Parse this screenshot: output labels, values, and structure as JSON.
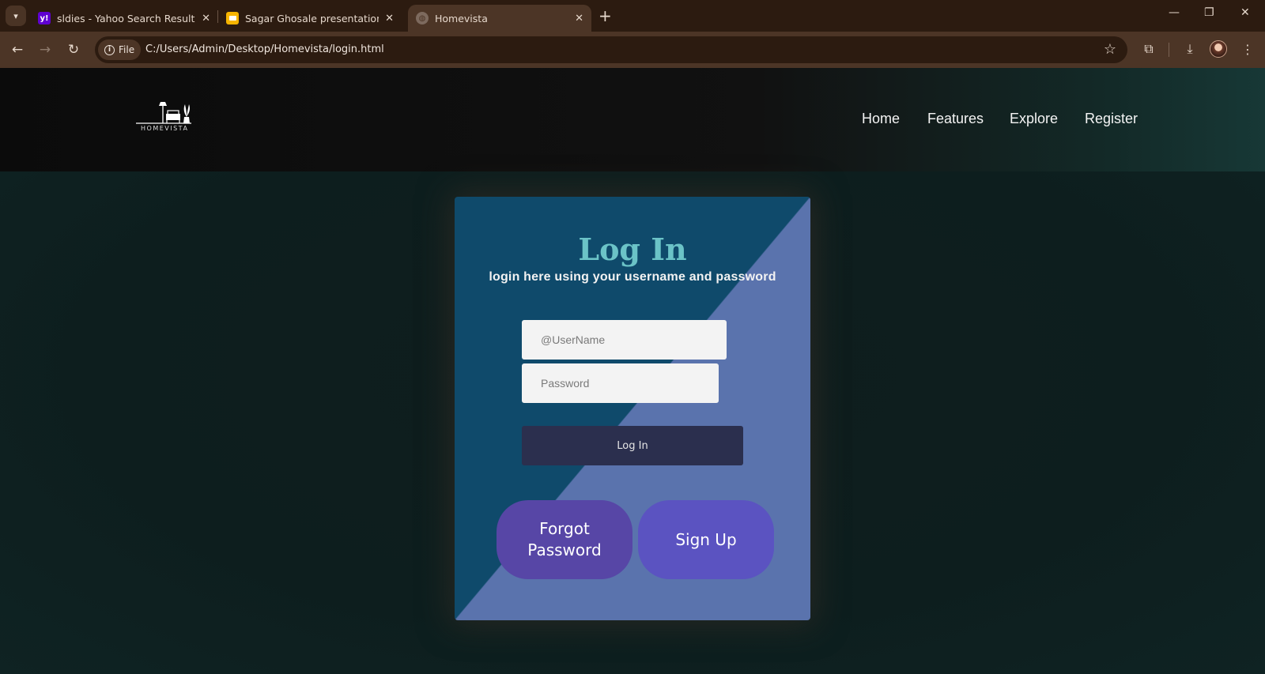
{
  "browser": {
    "tabs": [
      {
        "title": "sldies - Yahoo Search Results",
        "favicon": "yahoo-icon",
        "favicon_color": "#5f01d1"
      },
      {
        "title": "Sagar Ghosale presentation - G",
        "favicon": "slides-icon",
        "favicon_color": "#f6b400"
      },
      {
        "title": "Homevista",
        "favicon": "globe-icon",
        "active": true
      }
    ],
    "new_tab": "+",
    "address": {
      "chip_label": "File",
      "url": "C:/Users/Admin/Desktop/Homevista/login.html"
    }
  },
  "site": {
    "logo_text": "HOMEVISTA",
    "nav": [
      "Home",
      "Features",
      "Explore",
      "Register"
    ]
  },
  "login": {
    "title": "Log In",
    "subtitle": "login here using your username and password",
    "username_placeholder": "@UserName",
    "password_placeholder": "Password",
    "login_button": "Log In",
    "forgot_line1": "Forgot",
    "forgot_line2": "Password",
    "signup": "Sign Up"
  },
  "colors": {
    "card_dark": "#0f4a6b",
    "card_light": "#5a73ad",
    "title": "#6bc3c7",
    "login_button": "#2b2f4e",
    "forgot_button": "#5746a6",
    "signup_button": "#5b53c1"
  }
}
